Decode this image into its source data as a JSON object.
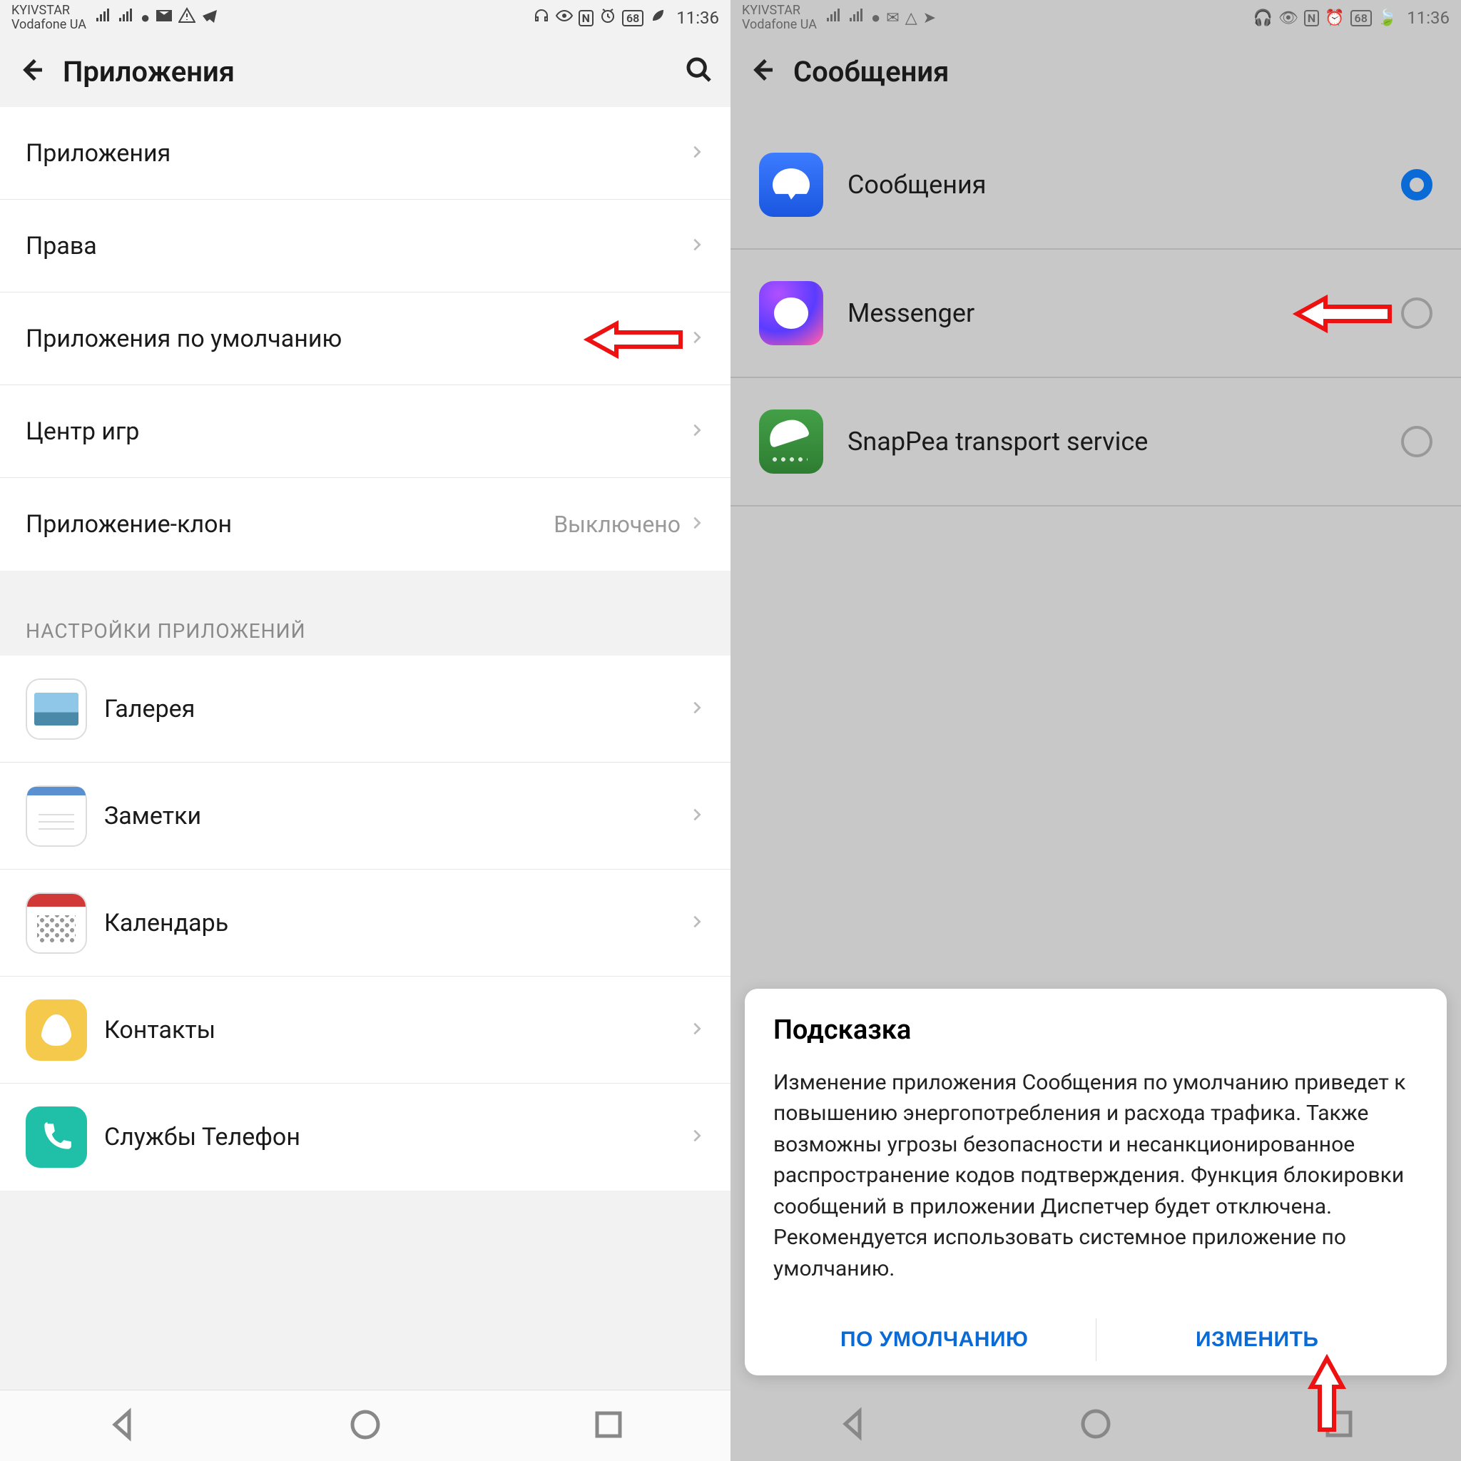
{
  "status": {
    "carrier1": "KYIVSTAR",
    "carrier2": "Vodafone UA",
    "battery": "68",
    "time": "11:36"
  },
  "left": {
    "title": "Приложения",
    "group1": [
      {
        "label": "Приложения"
      },
      {
        "label": "Права"
      },
      {
        "label": "Приложения по умолчанию"
      },
      {
        "label": "Центр игр"
      },
      {
        "label": "Приложение-клон",
        "value": "Выключено"
      }
    ],
    "section_header": "НАСТРОЙКИ ПРИЛОЖЕНИЙ",
    "group2": [
      {
        "label": "Галерея",
        "icon": "gallery"
      },
      {
        "label": "Заметки",
        "icon": "notes"
      },
      {
        "label": "Календарь",
        "icon": "calendar"
      },
      {
        "label": "Контакты",
        "icon": "contacts"
      },
      {
        "label": "Службы Телефон",
        "icon": "phone"
      }
    ]
  },
  "right": {
    "title": "Сообщения",
    "apps": [
      {
        "label": "Сообщения",
        "icon": "messages",
        "selected": true
      },
      {
        "label": "Messenger",
        "icon": "messenger",
        "selected": false
      },
      {
        "label": "SnapPea transport service",
        "icon": "snappea",
        "selected": false
      }
    ],
    "dialog": {
      "title": "Подсказка",
      "body": "Изменение приложения Сообщения по умолчанию приведет к повышению энергопотребления и расхода трафика. Также возможны угрозы безопасности и несанкционированное распространение кодов подтверждения. Функция блокировки сообщений в приложении Диспетчер будет отключена. Рекомендуется использовать системное приложение по умолчанию.",
      "default_btn": "ПО УМОЛЧАНИЮ",
      "change_btn": "ИЗМЕНИТЬ"
    }
  }
}
